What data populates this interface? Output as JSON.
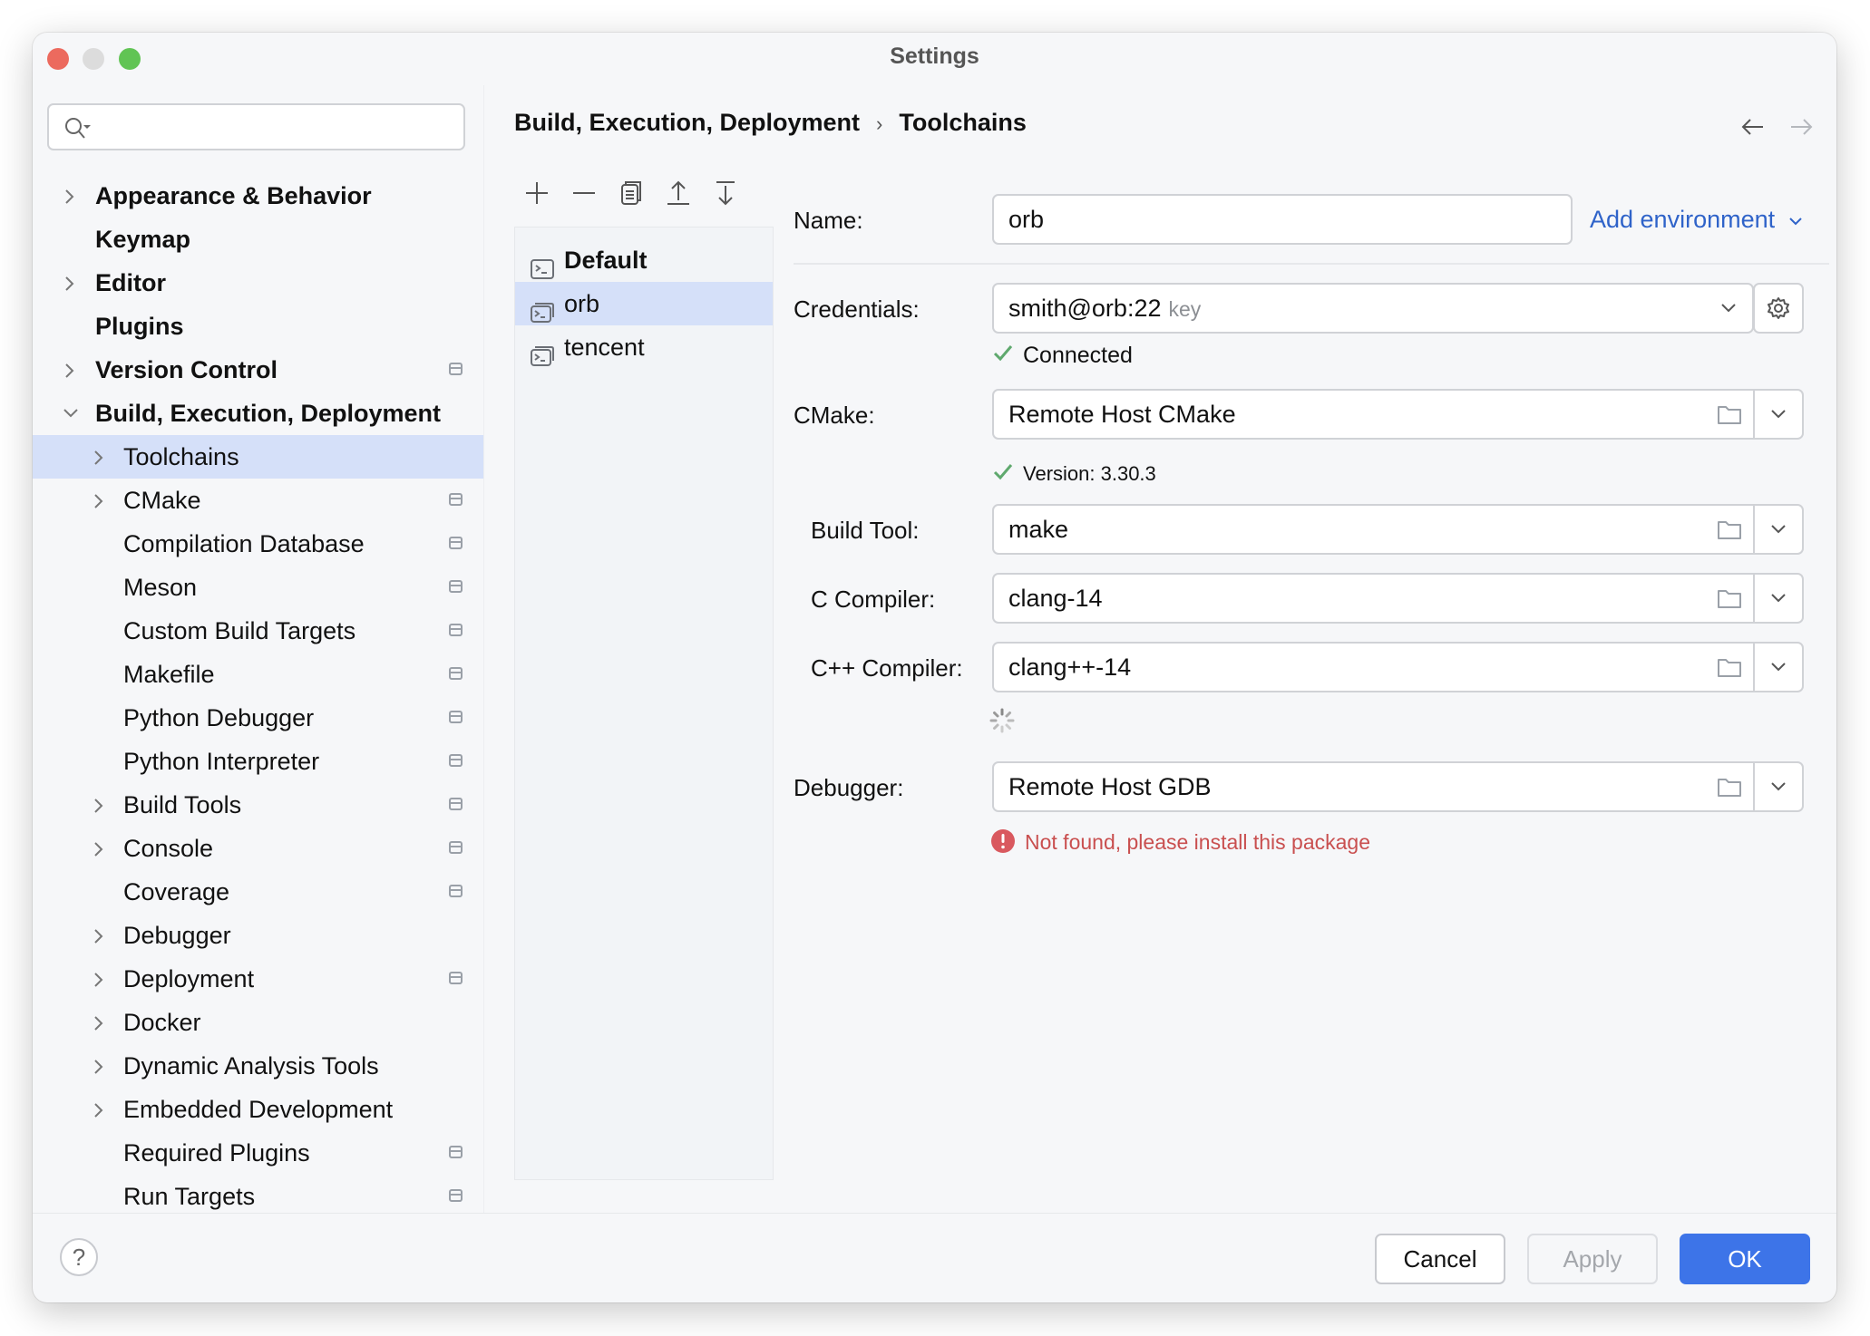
{
  "window": {
    "title": "Settings"
  },
  "search": {
    "placeholder": ""
  },
  "sidebar": {
    "items": [
      {
        "label": "Appearance & Behavior",
        "level": 0,
        "expandable": true,
        "expanded": false,
        "project": false
      },
      {
        "label": "Keymap",
        "level": 0,
        "expandable": false,
        "project": false
      },
      {
        "label": "Editor",
        "level": 0,
        "expandable": true,
        "expanded": false,
        "project": false
      },
      {
        "label": "Plugins",
        "level": 0,
        "expandable": false,
        "project": false
      },
      {
        "label": "Version Control",
        "level": 0,
        "expandable": true,
        "expanded": false,
        "project": true
      },
      {
        "label": "Build, Execution, Deployment",
        "level": 0,
        "expandable": true,
        "expanded": true,
        "project": false
      },
      {
        "label": "Toolchains",
        "level": 1,
        "expandable": true,
        "expanded": false,
        "project": false,
        "selected": true
      },
      {
        "label": "CMake",
        "level": 1,
        "expandable": true,
        "expanded": false,
        "project": true
      },
      {
        "label": "Compilation Database",
        "level": 1,
        "expandable": false,
        "project": true
      },
      {
        "label": "Meson",
        "level": 1,
        "expandable": false,
        "project": true
      },
      {
        "label": "Custom Build Targets",
        "level": 1,
        "expandable": false,
        "project": true
      },
      {
        "label": "Makefile",
        "level": 1,
        "expandable": false,
        "project": true
      },
      {
        "label": "Python Debugger",
        "level": 1,
        "expandable": false,
        "project": true
      },
      {
        "label": "Python Interpreter",
        "level": 1,
        "expandable": false,
        "project": true
      },
      {
        "label": "Build Tools",
        "level": 1,
        "expandable": true,
        "expanded": false,
        "project": true
      },
      {
        "label": "Console",
        "level": 1,
        "expandable": true,
        "expanded": false,
        "project": true
      },
      {
        "label": "Coverage",
        "level": 1,
        "expandable": false,
        "project": true
      },
      {
        "label": "Debugger",
        "level": 1,
        "expandable": true,
        "expanded": false,
        "project": false
      },
      {
        "label": "Deployment",
        "level": 1,
        "expandable": true,
        "expanded": false,
        "project": true
      },
      {
        "label": "Docker",
        "level": 1,
        "expandable": true,
        "expanded": false,
        "project": false
      },
      {
        "label": "Dynamic Analysis Tools",
        "level": 1,
        "expandable": true,
        "expanded": false,
        "project": false
      },
      {
        "label": "Embedded Development",
        "level": 1,
        "expandable": true,
        "expanded": false,
        "project": false
      },
      {
        "label": "Required Plugins",
        "level": 1,
        "expandable": false,
        "project": true
      },
      {
        "label": "Run Targets",
        "level": 1,
        "expandable": false,
        "project": true
      }
    ]
  },
  "breadcrumb": {
    "parent": "Build, Execution, Deployment",
    "separator": "›",
    "current": "Toolchains"
  },
  "toolchains": {
    "toolbar": [
      "add-icon",
      "remove-icon",
      "copy-icon",
      "move-up-icon",
      "move-down-icon"
    ],
    "items": [
      {
        "label": "Default",
        "bold": true,
        "selected": false
      },
      {
        "label": "orb",
        "bold": false,
        "selected": true
      },
      {
        "label": "tencent",
        "bold": false,
        "selected": false
      }
    ]
  },
  "form": {
    "name": {
      "label": "Name:",
      "value": "orb"
    },
    "add_environment": "Add environment",
    "credentials": {
      "label": "Credentials:",
      "value": "smith@orb:22",
      "hint": "key",
      "status": "Connected"
    },
    "cmake": {
      "label": "CMake:",
      "value": "Remote Host CMake",
      "status": "Version: 3.30.3"
    },
    "build_tool": {
      "label": "Build Tool:",
      "value": "make"
    },
    "c_compiler": {
      "label": "C Compiler:",
      "value": "clang-14"
    },
    "cpp_compiler": {
      "label": "C++ Compiler:",
      "value": "clang++-14"
    },
    "debugger": {
      "label": "Debugger:",
      "value": "Remote Host GDB",
      "error": "Not found, please install this package"
    }
  },
  "footer": {
    "help": "?",
    "cancel": "Cancel",
    "apply": "Apply",
    "ok": "OK"
  },
  "colors": {
    "accent": "#3d74e8",
    "link": "#2f63c9",
    "selection": "#d5e0f9",
    "success": "#5fa96e",
    "error": "#c94f4f"
  }
}
